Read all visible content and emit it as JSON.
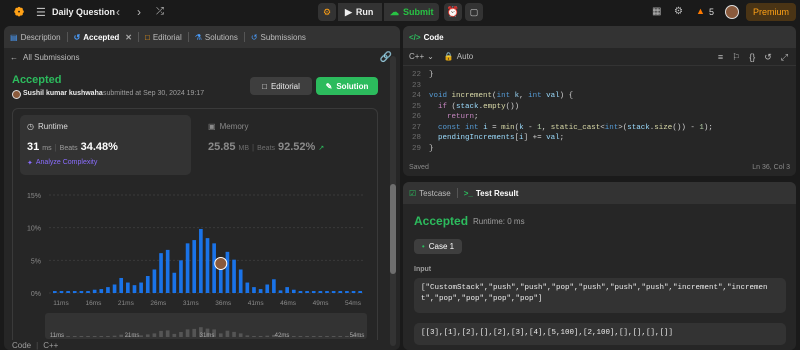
{
  "topbar": {
    "title": "Daily Question",
    "run": "Run",
    "submit": "Submit",
    "fire_count": "5",
    "premium": "Premium"
  },
  "left": {
    "tabs": [
      "Description",
      "Accepted",
      "Editorial",
      "Solutions",
      "Submissions"
    ],
    "all_submissions": "All Submissions",
    "status": "Accepted",
    "user": "Sushil kumar kushwaha",
    "submitted_at": "submitted at Sep 30, 2024 19:17",
    "editorial_btn": "Editorial",
    "solution_btn": "Solution",
    "runtime_label": "Runtime",
    "runtime_value": "31",
    "runtime_unit": "ms",
    "beats_label": "Beats",
    "runtime_beats": "34.48%",
    "analyze": "Analyze Complexity",
    "memory_label": "Memory",
    "memory_value": "25.85",
    "memory_unit": "MB",
    "memory_beats": "92.52%",
    "footer_code": "Code",
    "footer_lang": "C++"
  },
  "chart_data": {
    "type": "bar",
    "y_ticks": [
      "15%",
      "10%",
      "5%",
      "0%"
    ],
    "ylim": [
      0,
      15
    ],
    "x_ticks": [
      "11ms",
      "16ms",
      "21ms",
      "26ms",
      "31ms",
      "36ms",
      "41ms",
      "46ms",
      "49ms",
      "54ms"
    ],
    "values": [
      0.3,
      0.3,
      0.3,
      0.3,
      0.3,
      0.3,
      0.5,
      0.6,
      0.9,
      1.3,
      2.3,
      1.6,
      1.2,
      1.6,
      2.6,
      3.6,
      6.1,
      6.6,
      3.1,
      5.0,
      7.6,
      8.1,
      9.8,
      8.4,
      7.6,
      3.6,
      6.3,
      5.1,
      3.6,
      1.6,
      0.9,
      0.6,
      1.3,
      2.1,
      0.4,
      0.9,
      0.5,
      0.3,
      0.3,
      0.3,
      0.3,
      0.3,
      0.3,
      0.3,
      0.3,
      0.3,
      0.3
    ],
    "highlight_index": 25,
    "mini_ticks": [
      "11ms",
      "21ms",
      "31ms",
      "42ms",
      "54ms"
    ],
    "color": "#1a73e8"
  },
  "code": {
    "lang": "C++",
    "mode": "Auto",
    "status": "Saved",
    "cursor": "Ln 36, Col 3",
    "lines": [
      {
        "n": "22",
        "t": "}"
      },
      {
        "n": "23",
        "t": ""
      },
      {
        "n": "24",
        "t": "void increment(int k, int val) {"
      },
      {
        "n": "25",
        "t": "  if (stack.empty())"
      },
      {
        "n": "26",
        "t": "    return;"
      },
      {
        "n": "27",
        "t": "  const int i = min(k - 1, static_cast<int>(stack.size()) - 1);"
      },
      {
        "n": "28",
        "t": "  pendingIncrements[i] += val;"
      },
      {
        "n": "29",
        "t": "}"
      }
    ]
  },
  "result": {
    "tab_testcase": "Testcase",
    "tab_result": "Test Result",
    "status": "Accepted",
    "runtime": "Runtime: 0 ms",
    "case": "Case 1",
    "input_label": "Input",
    "input1": "[\"CustomStack\",\"push\",\"push\",\"pop\",\"push\",\"push\",\"push\",\"increment\",\"increment\",\"pop\",\"pop\",\"pop\",\"pop\"]",
    "input2": "[[3],[1],[2],[],[2],[3],[4],[5,100],[2,100],[],[],[],[]]"
  }
}
